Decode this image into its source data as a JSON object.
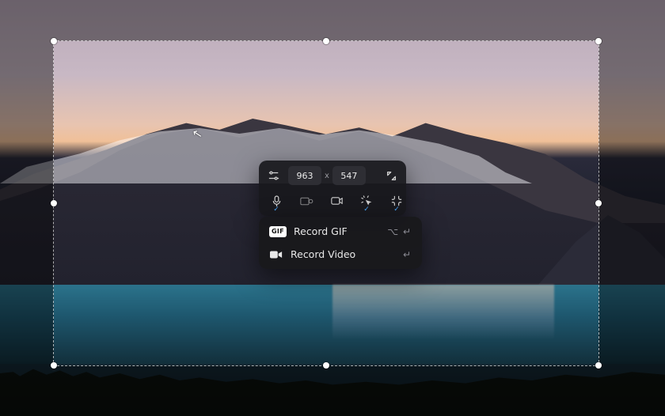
{
  "selection": {
    "width": "963",
    "separator": "x",
    "height": "547"
  },
  "actions": {
    "gif_badge": "GIF",
    "record_gif": "Record GIF",
    "record_gif_shortcut": "⌥ ↵",
    "record_video": "Record Video",
    "record_video_shortcut": "↵"
  }
}
